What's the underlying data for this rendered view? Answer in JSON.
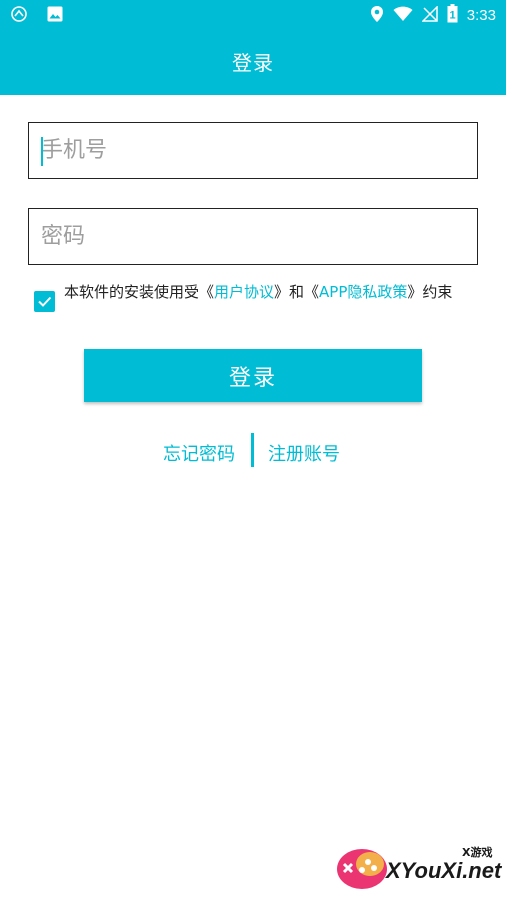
{
  "status_bar": {
    "time": "3:33",
    "battery_level": "1"
  },
  "app_bar": {
    "title": "登录"
  },
  "form": {
    "phone_placeholder": "手机号",
    "password_placeholder": "密码"
  },
  "agreement": {
    "checked": true,
    "prefix": "本软件的安装使用受《",
    "user_agreement": "用户协议",
    "middle": "》和《",
    "privacy_policy": "APP隐私政策",
    "suffix": "》约束"
  },
  "login_button": "登录",
  "links": {
    "forgot_password": "忘记密码",
    "register": "注册账号"
  },
  "watermark": {
    "main": "XYouXi.net",
    "small": "X游戏"
  },
  "colors": {
    "accent": "#00bcd4",
    "background": "#ffffff"
  }
}
